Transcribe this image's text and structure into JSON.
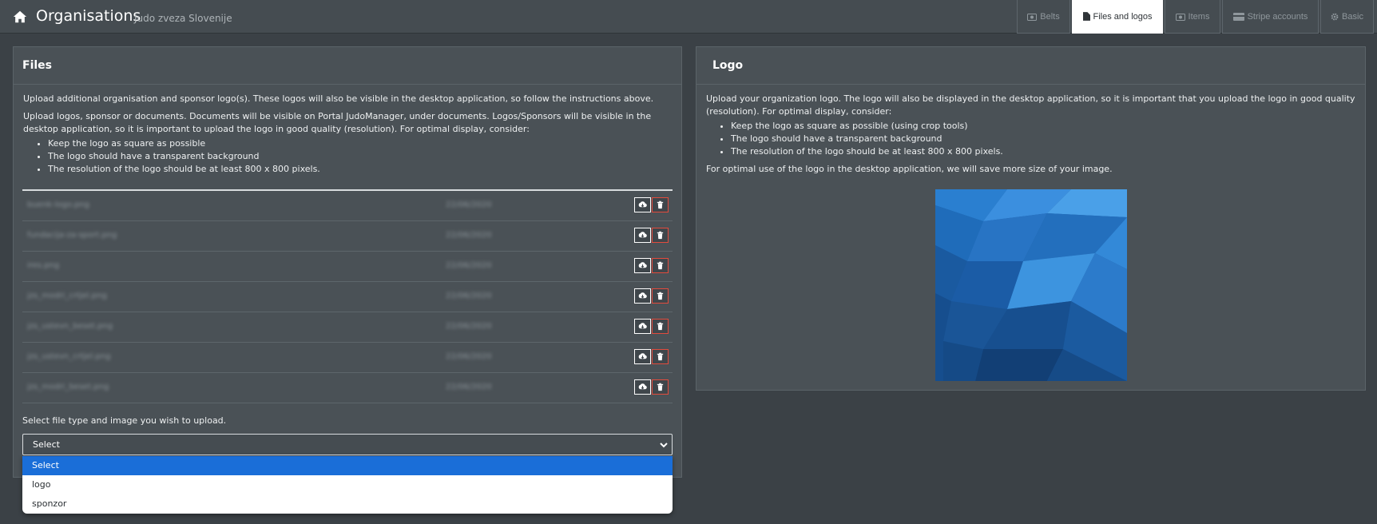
{
  "header": {
    "title": "Organisations",
    "subtitle": "Judo zveza Slovenije",
    "tabs": [
      {
        "label": "Belts",
        "icon": "camera-icon"
      },
      {
        "label": "Files and logos",
        "icon": "file-icon"
      },
      {
        "label": "Items",
        "icon": "camera-icon"
      },
      {
        "label": "Stripe accounts",
        "icon": "card-icon"
      },
      {
        "label": "Basic",
        "icon": "gear-icon"
      }
    ],
    "active_tab": "Files and logos"
  },
  "files_panel": {
    "title": "Files",
    "intro": "Upload additional organisation and sponsor logo(s). These logos will also be visible in the desktop application, so follow the instructions above.",
    "description": "Upload logos, sponsor or documents. Documents will be visible on Portal JudoManager, under documents. Logos/Sponsors will be visible in the desktop application, so it is important to upload the logo in good quality (resolution). For optimal display, consider:",
    "tips": [
      "Keep the logo as square as possible",
      "The logo should have a transparent background",
      "The resolution of the logo should be at least 800 x 800 pixels."
    ],
    "files": [
      {
        "name": "buenk-logo.png",
        "date": "22/06/2020"
      },
      {
        "name": "fundacija-za-sport.png",
        "date": "22/06/2020"
      },
      {
        "name": "ires.png",
        "date": "22/06/2020"
      },
      {
        "name": "jzs_modri_crtjel.png",
        "date": "22/06/2020"
      },
      {
        "name": "jzs_ustevn_beset.png",
        "date": "22/06/2020"
      },
      {
        "name": "jzs_ustevn_crtjel.png",
        "date": "22/06/2020"
      },
      {
        "name": "jzs_modri_beset.png",
        "date": "22/06/2020"
      }
    ],
    "upload_label": "Select file type and image you wish to upload.",
    "select": {
      "value": "Select",
      "options": [
        "Select",
        "logo",
        "sponzor"
      ],
      "highlighted": "Select"
    }
  },
  "logo_panel": {
    "title": "Logo",
    "description": "Upload your organization logo. The logo will also be displayed in the desktop application, so it is important that you upload the logo in good quality (resolution). For optimal display, consider:",
    "tips": [
      "Keep the logo as square as possible (using crop tools)",
      "The logo should have a transparent background",
      "The resolution of the logo should be at least 800 x 800 pixels."
    ],
    "note": "For optimal use of the logo in the desktop application, we will save more size of your image."
  },
  "colors": {
    "background": "#3b4146",
    "panel": "#4a5156",
    "active_tab": "#ffffff",
    "delete_red": "#e24b3d",
    "dropdown_highlight": "#1a6ed8",
    "logo_blue": "#1e5ea3"
  }
}
